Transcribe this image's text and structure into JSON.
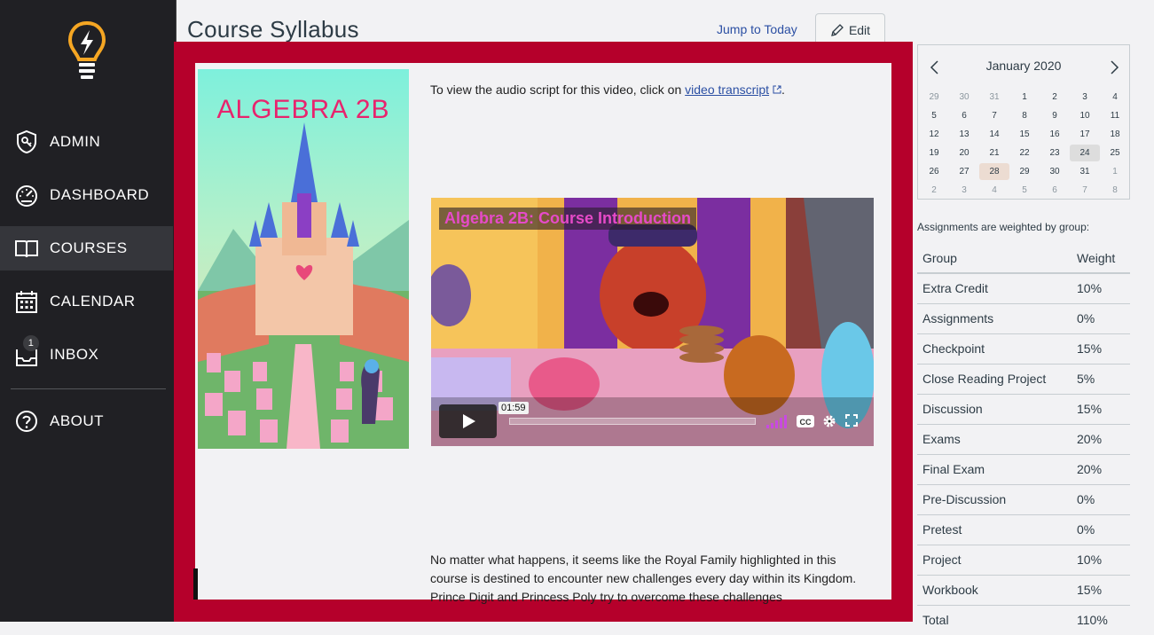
{
  "nav": {
    "items": [
      {
        "label": "ADMIN",
        "icon": "admin-shield-icon"
      },
      {
        "label": "DASHBOARD",
        "icon": "dashboard-gauge-icon"
      },
      {
        "label": "COURSES",
        "icon": "book-icon"
      },
      {
        "label": "CALENDAR",
        "icon": "calendar-icon"
      },
      {
        "label": "INBOX",
        "icon": "inbox-icon",
        "badge": "1"
      },
      {
        "label": "ABOUT",
        "icon": "question-icon"
      }
    ],
    "active": "COURSES"
  },
  "header": {
    "title": "Course Syllabus",
    "jump_link": "Jump to Today",
    "edit_label": "Edit"
  },
  "content": {
    "poster_title": "ALGEBRA 2B",
    "transcript_prefix": "To view the audio script for this video, click on",
    "transcript_link": "video transcript",
    "transcript_suffix": ".",
    "video": {
      "title": "Algebra 2B: Course Introduction",
      "time": "01:59"
    },
    "paragraph": "No matter what happens, it seems like the Royal Family highlighted in this course is destined to encounter new challenges every day within its Kingdom. Prince Digit and Princess Poly try to overcome these challenges"
  },
  "calendar": {
    "month": "January 2020",
    "days": [
      {
        "d": "29",
        "other": true
      },
      {
        "d": "30",
        "other": true
      },
      {
        "d": "31",
        "other": true
      },
      {
        "d": "1"
      },
      {
        "d": "2"
      },
      {
        "d": "3"
      },
      {
        "d": "4"
      },
      {
        "d": "5"
      },
      {
        "d": "6"
      },
      {
        "d": "7"
      },
      {
        "d": "8"
      },
      {
        "d": "9"
      },
      {
        "d": "10"
      },
      {
        "d": "11"
      },
      {
        "d": "12"
      },
      {
        "d": "13"
      },
      {
        "d": "14"
      },
      {
        "d": "15"
      },
      {
        "d": "16"
      },
      {
        "d": "17"
      },
      {
        "d": "18"
      },
      {
        "d": "19"
      },
      {
        "d": "20"
      },
      {
        "d": "21"
      },
      {
        "d": "22"
      },
      {
        "d": "23"
      },
      {
        "d": "24",
        "today": true
      },
      {
        "d": "25"
      },
      {
        "d": "26"
      },
      {
        "d": "27"
      },
      {
        "d": "28",
        "selected": true
      },
      {
        "d": "29"
      },
      {
        "d": "30"
      },
      {
        "d": "31"
      },
      {
        "d": "1",
        "other": true
      },
      {
        "d": "2",
        "other": true
      },
      {
        "d": "3",
        "other": true
      },
      {
        "d": "4",
        "other": true
      },
      {
        "d": "5",
        "other": true
      },
      {
        "d": "6",
        "other": true
      },
      {
        "d": "7",
        "other": true
      },
      {
        "d": "8",
        "other": true
      }
    ]
  },
  "weights": {
    "caption": "Assignments are weighted by group:",
    "headers": [
      "Group",
      "Weight"
    ],
    "rows": [
      [
        "Extra Credit",
        "10%"
      ],
      [
        "Assignments",
        "0%"
      ],
      [
        "Checkpoint",
        "15%"
      ],
      [
        "Close Reading Project",
        "5%"
      ],
      [
        "Discussion",
        "15%"
      ],
      [
        "Exams",
        "20%"
      ],
      [
        "Final Exam",
        "20%"
      ],
      [
        "Pre-Discussion",
        "0%"
      ],
      [
        "Pretest",
        "0%"
      ],
      [
        "Project",
        "10%"
      ],
      [
        "Workbook",
        "15%"
      ],
      [
        "Total",
        "110%"
      ]
    ]
  },
  "colors": {
    "sidebar": "#202024",
    "frame": "#b5002b",
    "link": "#2b4fa3",
    "video_title": "#e64ac8"
  }
}
